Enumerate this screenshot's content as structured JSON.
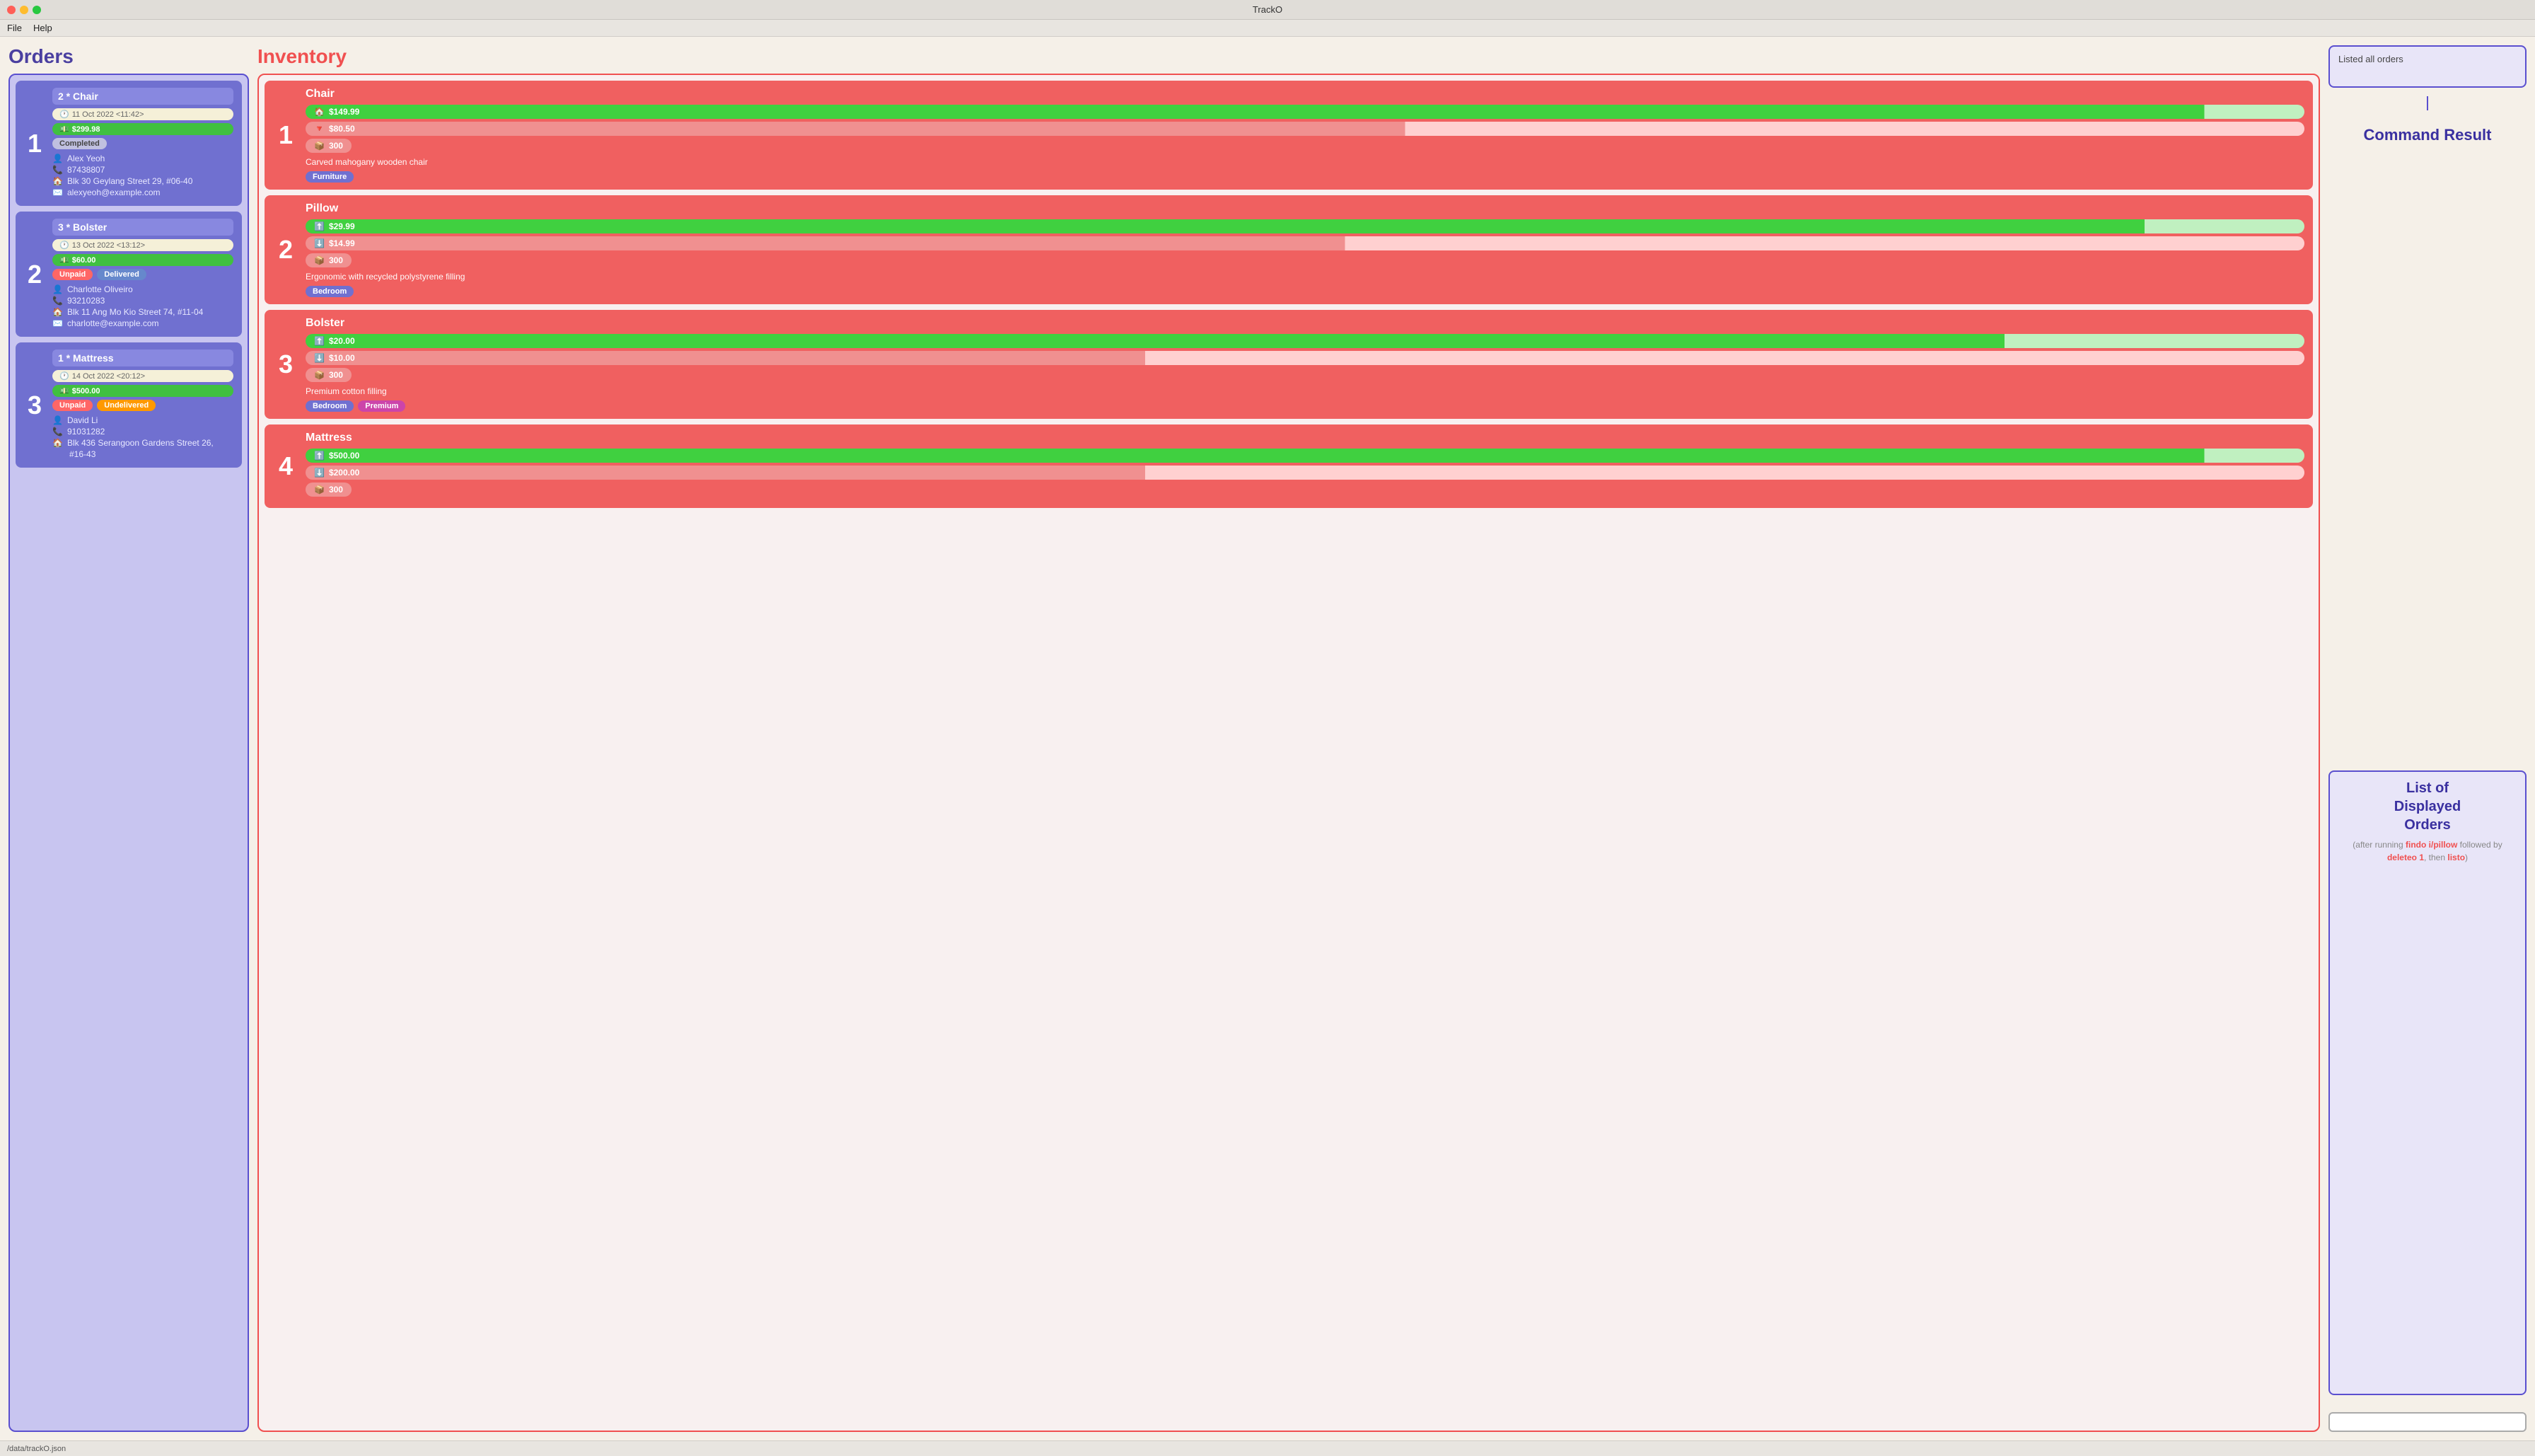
{
  "app": {
    "title": "TrackO",
    "menu": [
      "File",
      "Help"
    ]
  },
  "orders": {
    "section_title": "Orders",
    "items": [
      {
        "number": "1",
        "title": "2 * Chair",
        "date": "11 Oct 2022 <11:42>",
        "price": "$299.98",
        "statuses": [
          "Completed"
        ],
        "name": "Alex Yeoh",
        "phone": "87438807",
        "address": "Blk 30 Geylang Street 29, #06-40",
        "email": "alexyeoh@example.com"
      },
      {
        "number": "2",
        "title": "3 * Bolster",
        "date": "13 Oct 2022 <13:12>",
        "price": "$60.00",
        "statuses": [
          "Unpaid",
          "Delivered"
        ],
        "name": "Charlotte Oliveiro",
        "phone": "93210283",
        "address": "Blk 11 Ang Mo Kio Street 74, #11-04",
        "email": "charlotte@example.com"
      },
      {
        "number": "3",
        "title": "1 * Mattress",
        "date": "14 Oct 2022 <20:12>",
        "price": "$500.00",
        "statuses": [
          "Unpaid",
          "Undelivered"
        ],
        "name": "David Li",
        "phone": "91031282",
        "address": "Blk 436 Serangoon Gardens Street 26,",
        "address2": "#16-43",
        "email": ""
      }
    ]
  },
  "inventory": {
    "section_title": "Inventory",
    "items": [
      {
        "number": "1",
        "title": "Chair",
        "sell_price": "$149.99",
        "buy_price": "$80.50",
        "stock": "300",
        "description": "Carved mahogany wooden chair",
        "tags": [
          "Furniture"
        ],
        "sell_pct": 95,
        "buy_pct": 55
      },
      {
        "number": "2",
        "title": "Pillow",
        "sell_price": "$29.99",
        "buy_price": "$14.99",
        "stock": "300",
        "description": "Ergonomic with recycled polystyrene filling",
        "tags": [
          "Bedroom"
        ],
        "sell_pct": 92,
        "buy_pct": 52
      },
      {
        "number": "3",
        "title": "Bolster",
        "sell_price": "$20.00",
        "buy_price": "$10.00",
        "stock": "300",
        "description": "Premium cotton filling",
        "tags": [
          "Bedroom",
          "Premium"
        ],
        "sell_pct": 85,
        "buy_pct": 42
      },
      {
        "number": "4",
        "title": "Mattress",
        "sell_price": "$500.00",
        "buy_price": "$200.00",
        "stock": "300",
        "description": "",
        "tags": [],
        "sell_pct": 95,
        "buy_pct": 42
      }
    ]
  },
  "command_panel": {
    "result_text": "Listed all orders",
    "title": "Command Result",
    "list_title": "List of\nDisplayed\nOrders",
    "list_subtitle": "(after running findo i/pillow followed by deleteo 1, then listo)",
    "input_placeholder": "",
    "arrow_label": ""
  },
  "statusbar": {
    "text": "/data/trackO.json"
  }
}
